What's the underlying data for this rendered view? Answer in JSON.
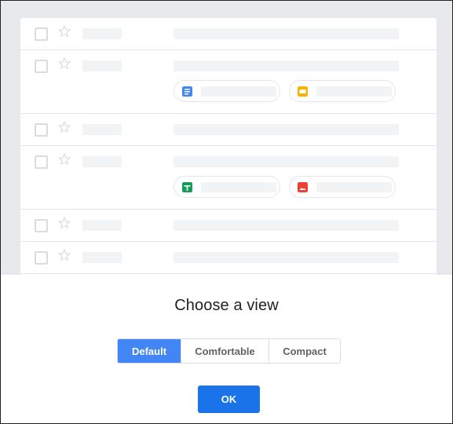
{
  "dialog": {
    "title": "Choose a view",
    "options": [
      {
        "label": "Default",
        "selected": true
      },
      {
        "label": "Comfortable",
        "selected": false
      },
      {
        "label": "Compact",
        "selected": false
      }
    ],
    "ok_label": "OK"
  },
  "preview": {
    "rows": [
      {
        "attachments": []
      },
      {
        "attachments": [
          {
            "icon": "docs-icon",
            "color": "#4285f4"
          },
          {
            "icon": "slides-icon",
            "color": "#f4b400"
          }
        ]
      },
      {
        "attachments": []
      },
      {
        "attachments": [
          {
            "icon": "sheets-icon",
            "color": "#0f9d58"
          },
          {
            "icon": "image-icon",
            "color": "#ea4335"
          }
        ]
      },
      {
        "attachments": []
      },
      {
        "attachments": []
      }
    ]
  },
  "colors": {
    "accent": "#1a73e8",
    "selected_segment": "#4285f4",
    "docs": "#4285f4",
    "slides": "#f4b400",
    "sheets": "#0f9d58",
    "photos": "#ea4335"
  }
}
